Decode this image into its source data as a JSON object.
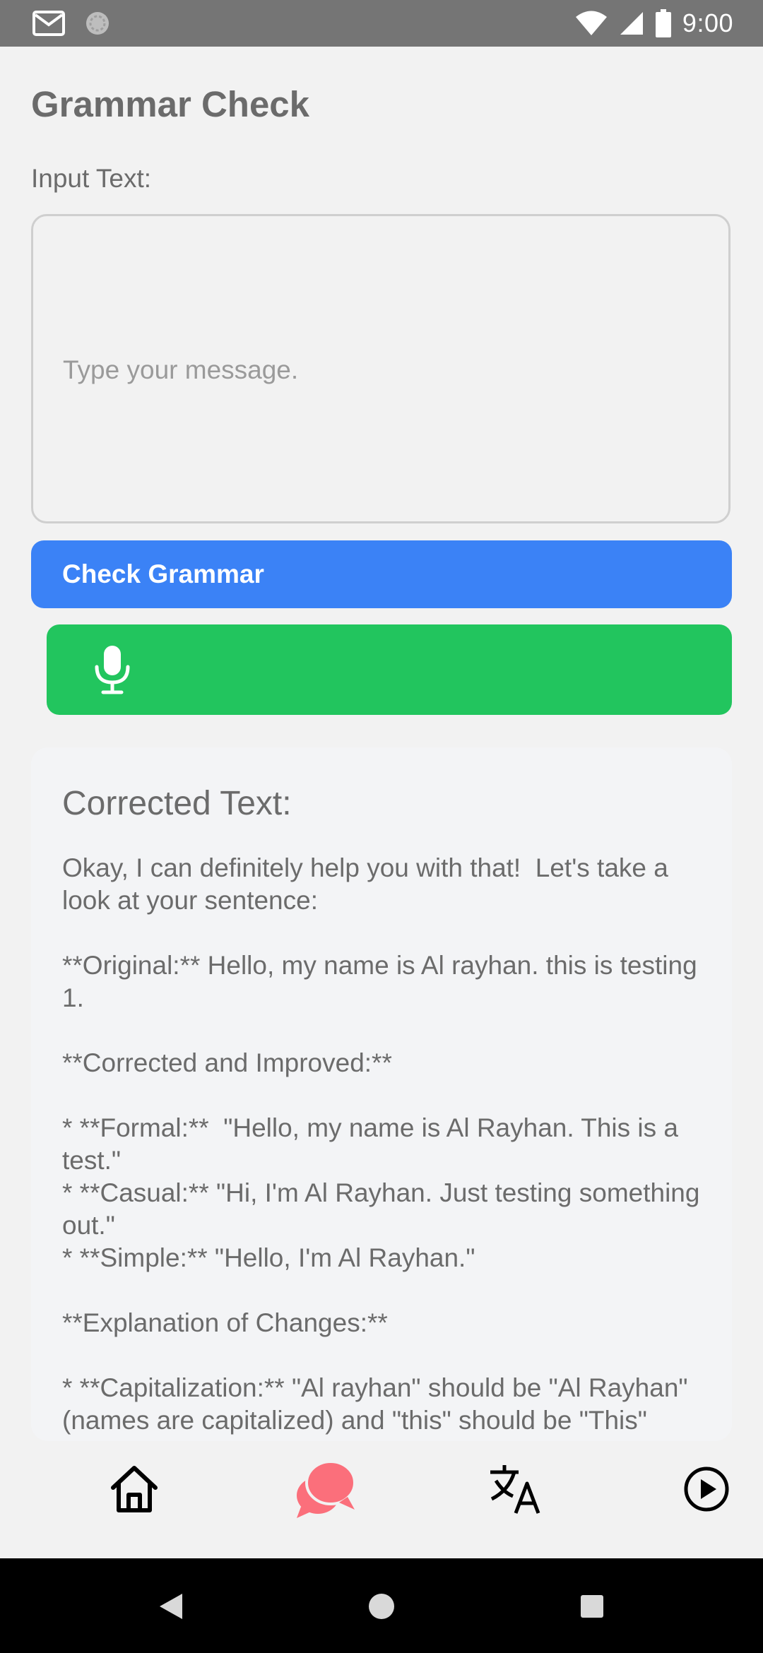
{
  "status_bar": {
    "time": "9:00",
    "icons": [
      "gmail-icon",
      "sync-icon",
      "wifi-icon",
      "signal-icon",
      "battery-icon"
    ]
  },
  "page": {
    "title": "Grammar Check",
    "input_label": "Input Text:",
    "input_placeholder": "Type your message.",
    "input_value": "",
    "check_button_label": "Check Grammar",
    "mic_button_icon": "microphone-icon"
  },
  "result": {
    "heading": "Corrected Text:",
    "text": "Okay, I can definitely help you with that!  Let's take a look at your sentence:\n\n**Original:** Hello, my name is Al rayhan. this is testing 1.\n\n**Corrected and Improved:**\n\n* **Formal:**  \"Hello, my name is Al Rayhan. This is a test.\"\n* **Casual:** \"Hi, I'm Al Rayhan. Just testing something out.\"\n* **Simple:** \"Hello, I'm Al Rayhan.\"\n\n**Explanation of Changes:**\n\n* **Capitalization:** \"Al rayhan\" should be \"Al Rayhan\" (names are capitalized) and \"this\" should be \"This\" (beginning of a sentence)."
  },
  "bottom_nav": {
    "items": [
      {
        "icon": "home-icon",
        "active": false
      },
      {
        "icon": "chat-icon",
        "active": true
      },
      {
        "icon": "translate-icon",
        "active": false
      },
      {
        "icon": "play-icon",
        "active": false
      }
    ]
  },
  "colors": {
    "background": "#f2f2f2",
    "status_bar": "#757575",
    "text": "#6b6b6b",
    "check_button": "#3b82f6",
    "mic_button": "#22c55e",
    "active_nav": "#fb6f7b"
  }
}
